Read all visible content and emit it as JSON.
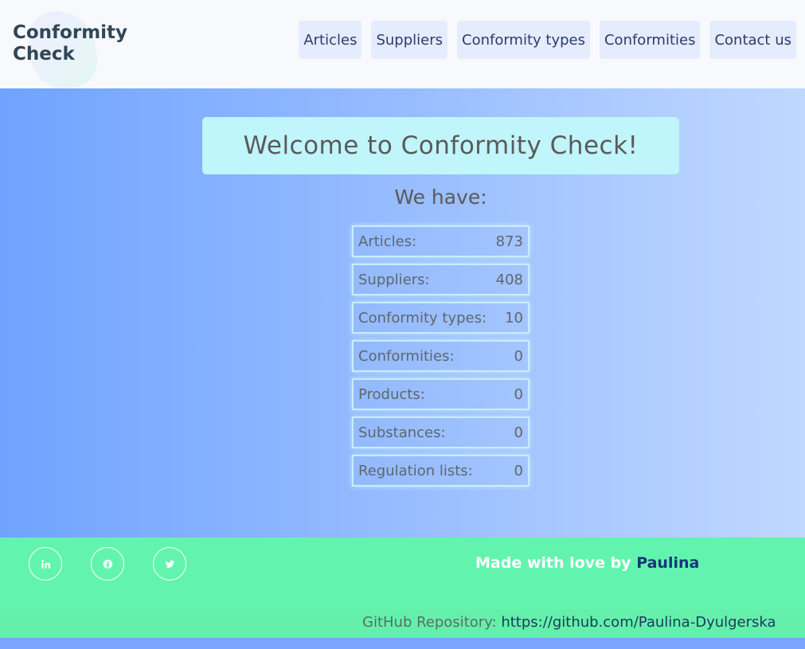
{
  "header": {
    "logo_line1": "Conformity",
    "logo_line2": "Check",
    "nav": [
      "Articles",
      "Suppliers",
      "Conformity types",
      "Conformities",
      "Contact us"
    ]
  },
  "main": {
    "welcome": "Welcome to Conformity Check!",
    "we_have": "We have:",
    "stats": [
      {
        "label": "Articles:",
        "value": "873"
      },
      {
        "label": "Suppliers:",
        "value": "408"
      },
      {
        "label": "Conformity types:",
        "value": "10"
      },
      {
        "label": "Conformities:",
        "value": "0"
      },
      {
        "label": "Products:",
        "value": "0"
      },
      {
        "label": "Substances:",
        "value": "0"
      },
      {
        "label": "Regulation lists:",
        "value": "0"
      }
    ]
  },
  "footer": {
    "social_icons": [
      "linkedin-icon",
      "facebook-icon",
      "twitter-icon"
    ],
    "made_with": "Made with love by",
    "author": "Paulina",
    "github_label": "GitHub Repository:",
    "github_url": "https://github.com/Paulina-Dyulgerska"
  },
  "colors": {
    "accent_main_start": "#70a3ff",
    "footer": "#62f4ae",
    "welcome_box": "#bff5fb",
    "nav_item": "#e5ecfd"
  }
}
